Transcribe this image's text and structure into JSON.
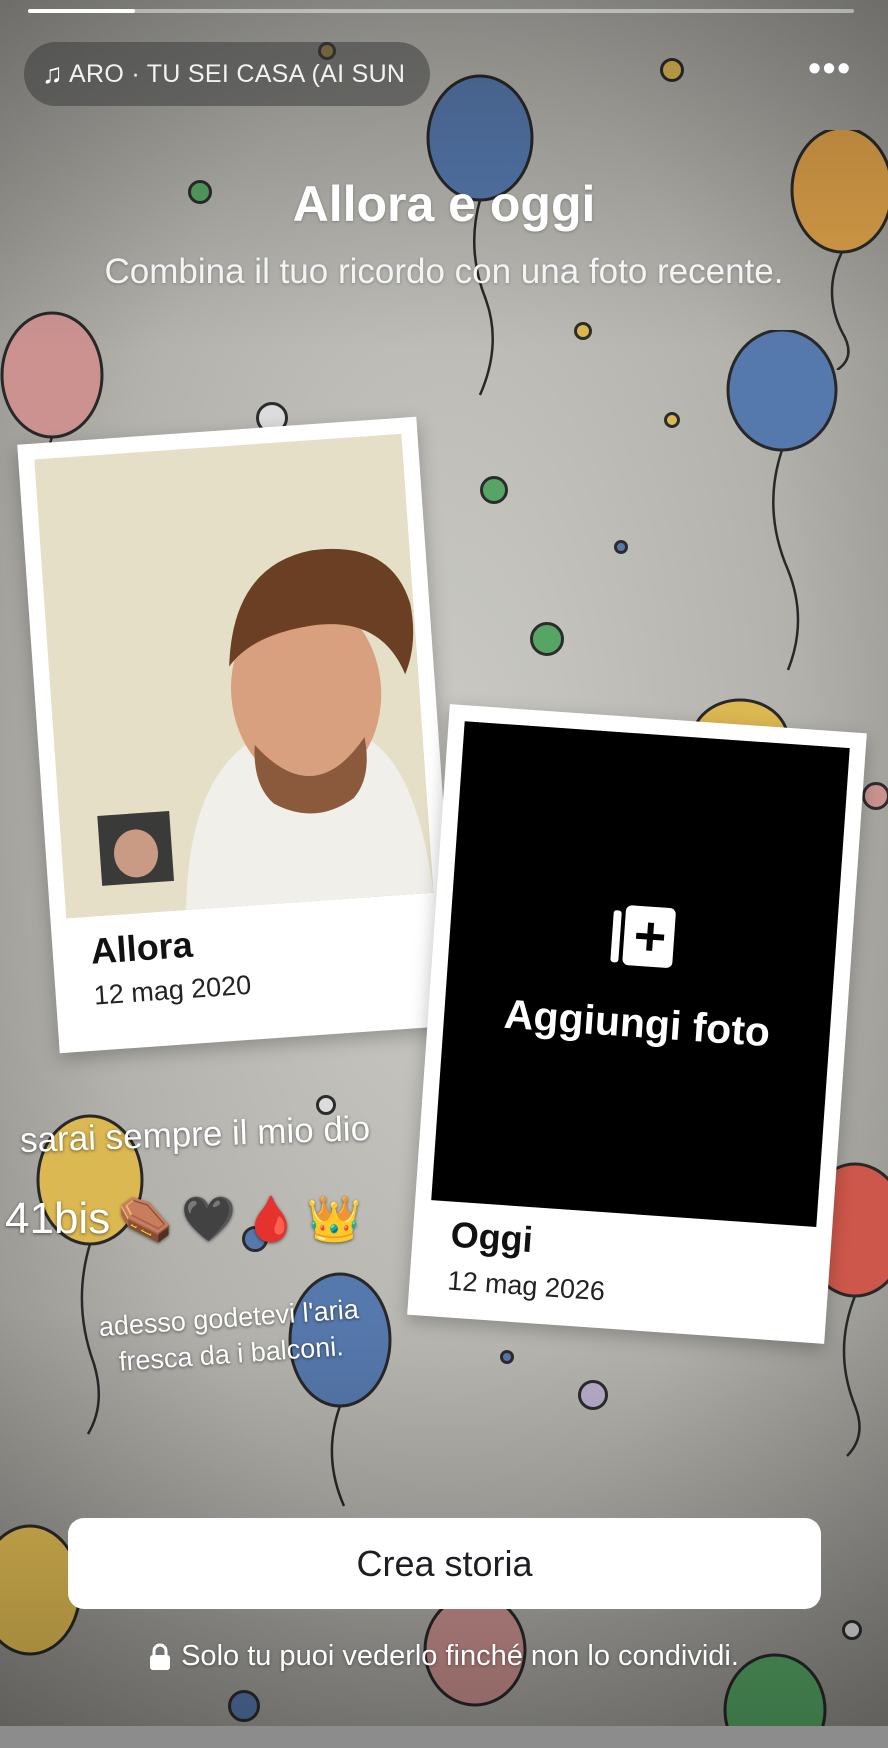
{
  "story": {
    "progress": 0.13
  },
  "music": {
    "icon": "music-note-icon",
    "track": "ARO · TU SEI CASA (AI SUN"
  },
  "menu": {
    "icon": "more-dots-icon",
    "label": "•••"
  },
  "header": {
    "title": "Allora e oggi",
    "subtitle": "Combina il tuo ricordo con una foto recente."
  },
  "cards": {
    "then": {
      "caption": "Allora",
      "date": "12 mag 2020"
    },
    "now": {
      "caption": "Oggi",
      "date": "12 mag 2026",
      "add_label": "Aggiungi foto",
      "add_icon": "add-photo-icon"
    }
  },
  "overlay": {
    "line1": "sarai sempre il mio dio",
    "line2_text": "41bis",
    "line2_emojis": [
      "⚰️",
      "🖤",
      "🩸",
      "👑"
    ],
    "line3": "adesso godetevi l'aria fresca da i balconi."
  },
  "cta": {
    "label": "Crea storia"
  },
  "privacy": {
    "icon": "lock-icon",
    "text": "Solo tu puoi vederlo finché non lo condividi."
  },
  "colors": {
    "background": "#c8c7c1",
    "balloon_blue": "#5b7fb6",
    "balloon_yellow": "#e8c256",
    "balloon_pink": "#d69a98",
    "balloon_red": "#d85c4e",
    "balloon_orange": "#e4a64c",
    "dot_green": "#5aae6a",
    "button_bg": "#ffffff"
  }
}
